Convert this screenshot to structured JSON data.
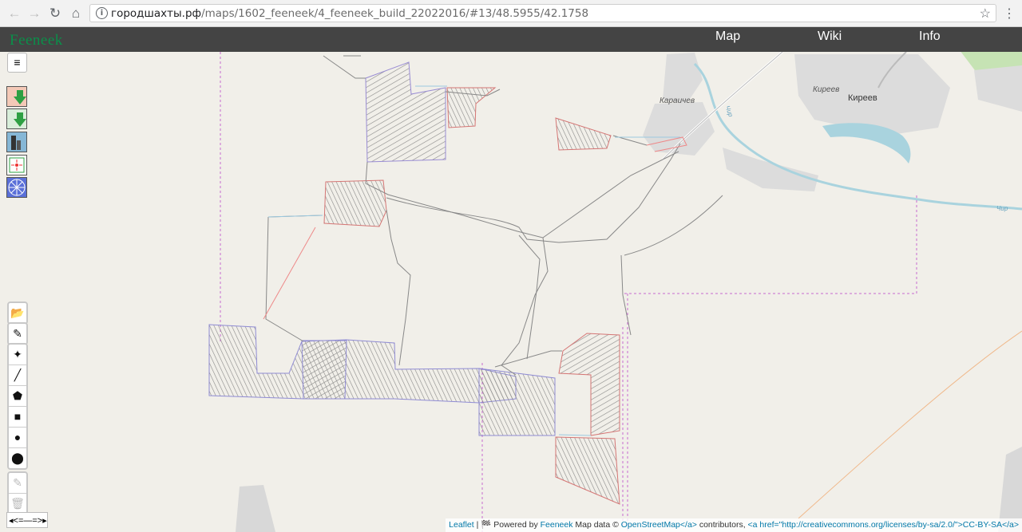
{
  "browser": {
    "url_host": "городшахты.рф",
    "url_path": "/maps/1602_feeneek/4_feeneek_build_22022016/#13/48.5955/42.1758",
    "back": "←",
    "forward": "→",
    "reload": "↻",
    "home": "⌂",
    "star": "☆",
    "menu": "⋮",
    "info": "i"
  },
  "header": {
    "logo": "Feeneek",
    "nav": [
      "Map",
      "Wiki",
      "Info"
    ]
  },
  "map": {
    "places": {
      "karaichev": "Караичев",
      "kireev_italic": "Киреев",
      "kireev": "Киреев",
      "river1": "Чир",
      "river2": "Чир"
    },
    "layer_menu": "≡",
    "draw_tools": {
      "open": "📂",
      "pen": "✎",
      "magic": "✦",
      "line": "╱",
      "polygon": "⬟",
      "rectangle": "■",
      "circle": "●",
      "marker": "⬤",
      "edit": "✎",
      "delete": "🗑"
    },
    "toggle": "◂<=—=>▸",
    "attribution": {
      "leaflet": "Leaflet",
      "sep": " | 🏁 Powered by ",
      "feeneek": "Feeneek",
      "mapdata": " Map data © ",
      "osm": "OpenStreetMap</a>",
      "contrib": " contributors, ",
      "license": "<a href=\"http://creativecommons.org/licenses/by-sa/2.0/\">CC-BY-SA</a>"
    }
  },
  "colors": {
    "header_bg": "#444444",
    "map_bg": "#f1efe9",
    "logo": "#0b8f4a",
    "boundary": "#c86bd0",
    "river": "#a9d3de"
  }
}
